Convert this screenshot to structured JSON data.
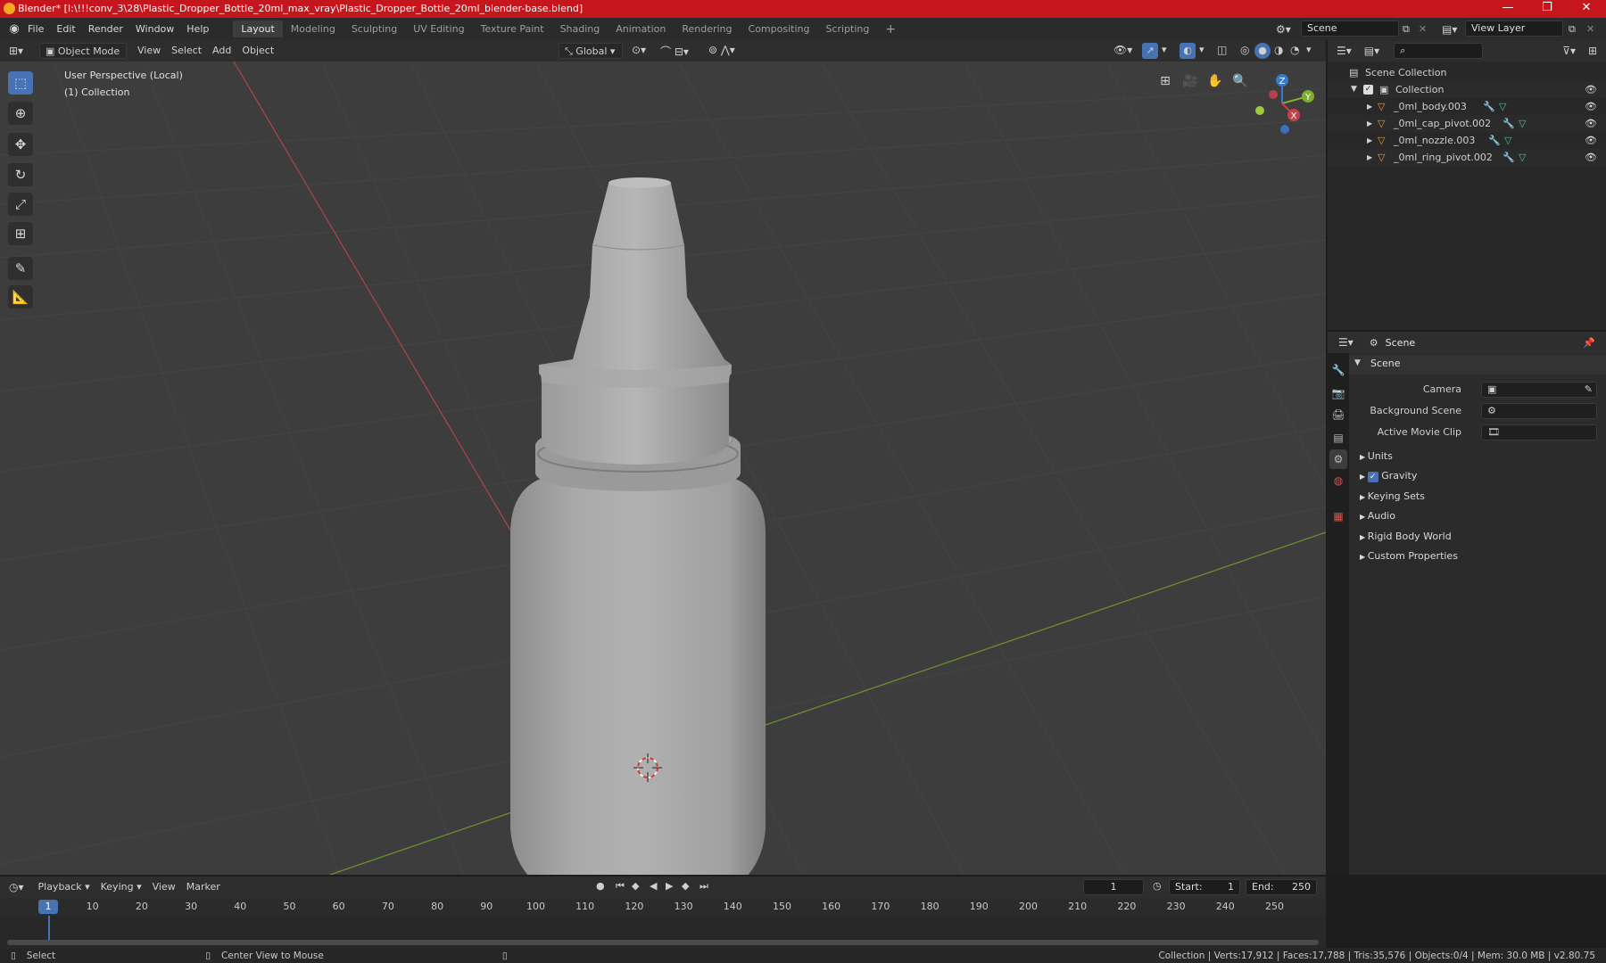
{
  "title_bar": {
    "title": "Blender* [I:\\!!!conv_3\\28\\Plastic_Dropper_Bottle_20ml_max_vray\\Plastic_Dropper_Bottle_20ml_blender-base.blend]",
    "minimize": "—",
    "maximize": "❐",
    "close": "✕"
  },
  "menu": [
    "File",
    "Edit",
    "Render",
    "Window",
    "Help"
  ],
  "workspaces": [
    "Layout",
    "Modeling",
    "Sculpting",
    "UV Editing",
    "Texture Paint",
    "Shading",
    "Animation",
    "Rendering",
    "Compositing",
    "Scripting"
  ],
  "active_workspace": "Layout",
  "add_workspace": "+",
  "scene_field": "Scene",
  "view_layer_field": "View Layer",
  "viewport_header": {
    "mode": "Object Mode",
    "view": "View",
    "select": "Select",
    "add": "Add",
    "object": "Object",
    "transform_orientation": "Global"
  },
  "viewport": {
    "perspective": "User Perspective (Local)",
    "collection": "(1) Collection",
    "gizmo_axes": {
      "x": "X",
      "y": "Y",
      "z": "Z"
    }
  },
  "outliner": {
    "scene_collection": "Scene Collection",
    "collection": "Collection",
    "objects": [
      "_0ml_body.003",
      "_0ml_cap_pivot.002",
      "_0ml_nozzle.003",
      "_0ml_ring_pivot.002"
    ]
  },
  "properties": {
    "header": "Scene",
    "panel": "Scene",
    "camera_label": "Camera",
    "background_scene_label": "Background Scene",
    "active_movie_clip_label": "Active Movie Clip",
    "sections": [
      "Units",
      "Gravity",
      "Keying Sets",
      "Audio",
      "Rigid Body World",
      "Custom Properties"
    ],
    "gravity_checked": true
  },
  "timeline": {
    "playback": "Playback",
    "keying": "Keying",
    "view": "View",
    "marker": "Marker",
    "current_frame": "1",
    "start_label": "Start:",
    "start": "1",
    "end_label": "End:",
    "end": "250",
    "ruler": [
      "1",
      "10",
      "20",
      "30",
      "40",
      "50",
      "60",
      "70",
      "80",
      "90",
      "100",
      "110",
      "120",
      "130",
      "140",
      "150",
      "160",
      "170",
      "180",
      "190",
      "200",
      "210",
      "220",
      "230",
      "240",
      "250"
    ]
  },
  "status_bar": {
    "select": "Select",
    "center_view": "Center View to Mouse",
    "stats": "Collection | Verts:17,912 | Faces:17,788 | Tris:35,576 | Objects:0/4 | Mem: 30.0 MB | v2.80.75"
  },
  "colors": {
    "title_red": "#c4161c",
    "accent_blue": "#4772b3",
    "axis_x": "#c8414a",
    "axis_y": "#7fae2f",
    "axis_z": "#3a78c8",
    "object_orange": "#e89a3c"
  }
}
